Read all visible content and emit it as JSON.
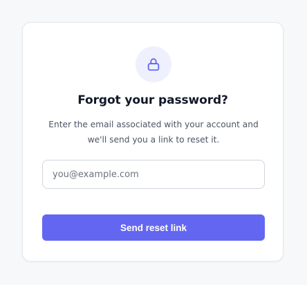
{
  "form": {
    "title": "Forgot your password?",
    "subtitle": "Enter the email associated with your account and we'll send you a link to reset it.",
    "email_placeholder": "you@example.com",
    "email_value": "",
    "submit_label": "Send reset link",
    "icon": "lock-icon"
  },
  "colors": {
    "page_background": "#f7f8fa",
    "card_background": "#ffffff",
    "accent": "#6366f1",
    "icon_background": "#eef0fd",
    "title_text": "#111827",
    "body_text": "#4b5563"
  }
}
